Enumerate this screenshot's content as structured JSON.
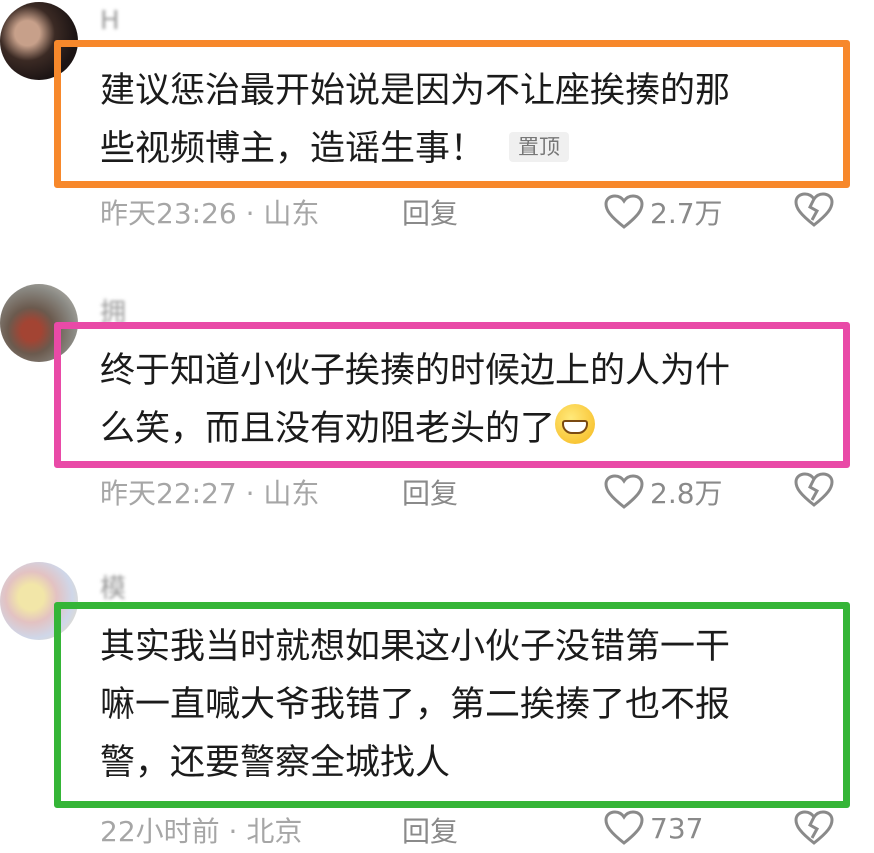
{
  "comments": [
    {
      "username": "H",
      "text_line1": "建议惩治最开始说是因为不让座挨揍的那",
      "text_line2": "些视频博主，造谣生事！",
      "pinned_label": "置顶",
      "time": "昨天23:26 · 山东",
      "reply_label": "回复",
      "likes": "2.7万",
      "highlight_color": "#f7882b"
    },
    {
      "username": "拥",
      "text_line1": "终于知道小伙子挨揍的时候边上的人为什",
      "text_line2": "么笑，而且没有劝阻老头的了",
      "emoji": "grinning-face-emoji",
      "time": "昨天22:27 · 山东",
      "reply_label": "回复",
      "likes": "2.8万",
      "highlight_color": "#e94aa7"
    },
    {
      "username": "模",
      "text_line1": "其实我当时就想如果这小伙子没错第一干",
      "text_line2": "嘛一直喊大爷我错了，第二挨揍了也不报",
      "text_line3": "警，还要警察全城找人",
      "time": "22小时前 · 北京",
      "reply_label": "回复",
      "likes": "737",
      "highlight_color": "#35b537"
    }
  ],
  "icons": {
    "like": "heart-outline-icon",
    "dislike": "broken-heart-icon"
  }
}
